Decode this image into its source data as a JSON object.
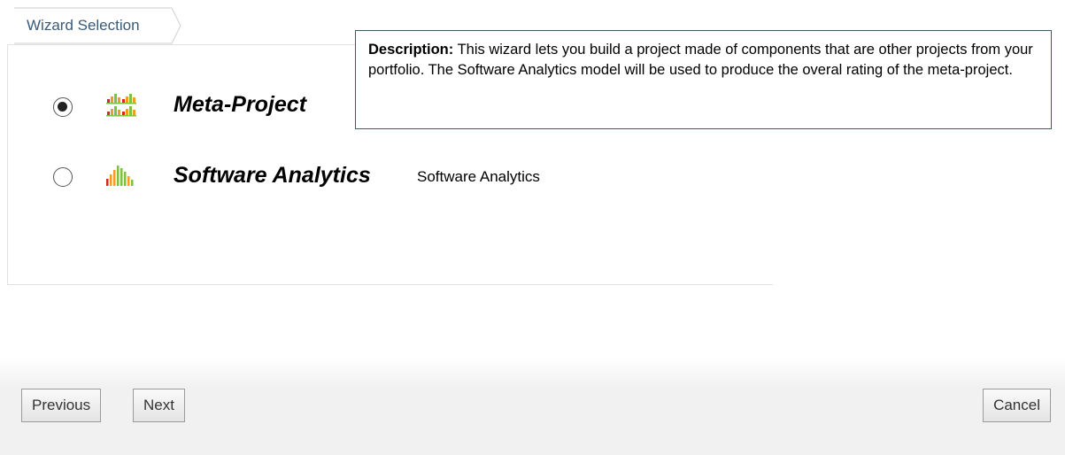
{
  "breadcrumb": {
    "label": "Wizard Selection"
  },
  "wizards": [
    {
      "name": "Meta-Project",
      "description_inline": "",
      "selected": true,
      "icon": "meta-project-icon"
    },
    {
      "name": "Software Analytics",
      "description_inline": "Software Analytics",
      "selected": false,
      "icon": "software-analytics-icon"
    }
  ],
  "description": {
    "label": "Description:",
    "text": "This wizard lets you build a project made of components that are other projects from your portfolio. The Software Analytics model will be used to produce the overal rating of the meta-project."
  },
  "buttons": {
    "previous": "Previous",
    "next": "Next",
    "cancel": "Cancel"
  },
  "colors": {
    "crumb_text": "#3a5a78",
    "tooltip_border": "#3d5a69",
    "icon_green": "#7cc242",
    "icon_orange": "#f39c1f",
    "icon_red": "#d9261c"
  }
}
